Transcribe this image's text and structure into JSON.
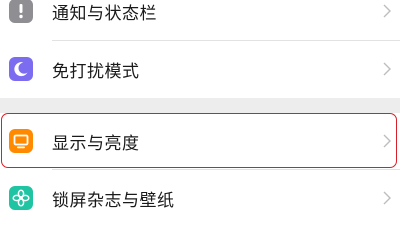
{
  "settings": {
    "items": [
      {
        "label": "通知与状态栏",
        "icon": "notification-icon",
        "icon_color": "#8e8e93"
      },
      {
        "label": "免打扰模式",
        "icon": "moon-icon",
        "icon_color": "#7b6cf0"
      },
      {
        "label": "显示与亮度",
        "icon": "display-icon",
        "icon_color": "#ff8a00"
      },
      {
        "label": "锁屏杂志与壁纸",
        "icon": "flower-icon",
        "icon_color": "#1fc4a2"
      }
    ]
  },
  "highlight_color": "#d8202a"
}
